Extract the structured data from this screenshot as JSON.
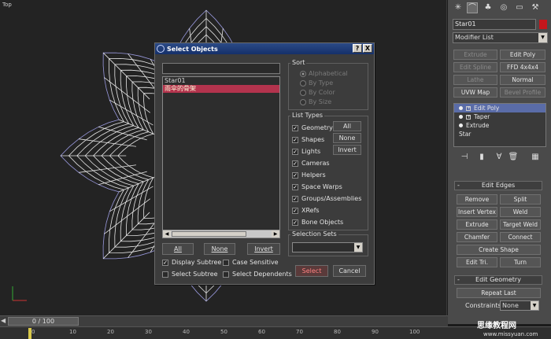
{
  "viewport": {
    "label": "Top"
  },
  "dialog": {
    "title": "Select Objects",
    "help_label": "?",
    "close_label": "X",
    "filter_value": "",
    "objects": [
      "Star01",
      "雨伞的骨架"
    ],
    "list_buttons": [
      "All",
      "None",
      "Invert"
    ],
    "sort": {
      "title": "Sort",
      "options": [
        "Alphabetical",
        "By Type",
        "By Color",
        "By Size"
      ],
      "selected": "Alphabetical"
    },
    "list_types": {
      "title": "List Types",
      "items": [
        "Geometry",
        "Shapes",
        "Lights",
        "Cameras",
        "Helpers",
        "Space Warps",
        "Groups/Assemblies",
        "XRefs",
        "Bone Objects"
      ],
      "buttons": [
        "All",
        "None",
        "Invert"
      ]
    },
    "selection_sets": {
      "title": "Selection Sets",
      "value": ""
    },
    "options": [
      "Display Subtree",
      "Case Sensitive",
      "Select Subtree",
      "Select Dependents"
    ],
    "select_label": "Select",
    "cancel_label": "Cancel"
  },
  "panel": {
    "object_name": "Star01",
    "object_color": "#c4161c",
    "modifier_list": "Modifier List",
    "buttons": [
      {
        "label": "Extrude",
        "enabled": false
      },
      {
        "label": "Edit Poly",
        "enabled": true
      },
      {
        "label": "Edit Spline",
        "enabled": false
      },
      {
        "label": "FFD 4x4x4",
        "enabled": true
      },
      {
        "label": "Lathe",
        "enabled": false
      },
      {
        "label": "Normal",
        "enabled": true
      },
      {
        "label": "UVW Map",
        "enabled": true
      },
      {
        "label": "Bevel Profile",
        "enabled": false
      }
    ],
    "stack": [
      "Edit Poly",
      "Taper",
      "Extrude",
      "Star"
    ],
    "edit_edges": {
      "title": "Edit Edges",
      "buttons": [
        "Remove",
        "Split",
        "Insert Vertex",
        "Weld",
        "Extrude",
        "Target Weld",
        "Chamfer",
        "Connect",
        "Create Shape",
        "Edit Tri.",
        "Turn"
      ]
    },
    "edit_geometry": {
      "title": "Edit Geometry",
      "repeat_last": "Repeat Last",
      "constraints_label": "Constraints:",
      "constraints_value": "None"
    }
  },
  "timeline": {
    "frame": "0 / 100",
    "ticks": [
      "0",
      "10",
      "20",
      "30",
      "40",
      "50",
      "60",
      "70",
      "80",
      "90",
      "100"
    ]
  },
  "watermark": {
    "line1": "思缘教程网",
    "line2": "www.missyuan.com"
  }
}
